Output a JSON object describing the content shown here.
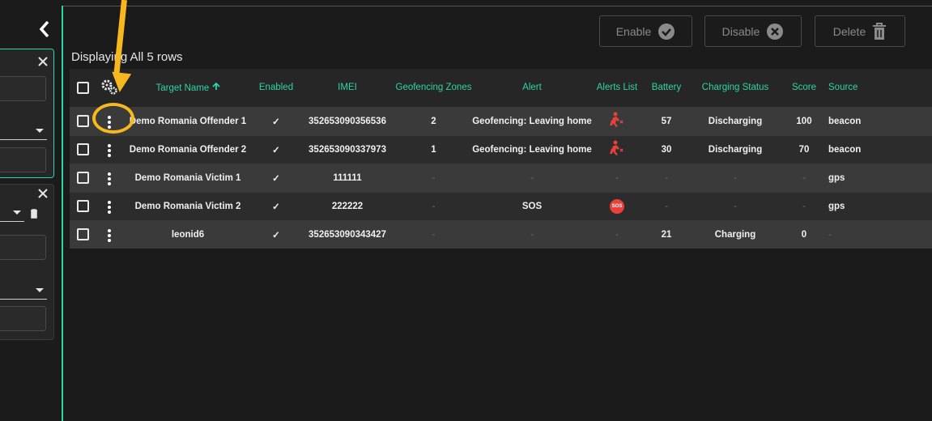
{
  "toolbar": {
    "enable_label": "Enable",
    "disable_label": "Disable",
    "delete_label": "Delete"
  },
  "caption": "Displaying All 5 rows",
  "table": {
    "headers": {
      "target_name": "Target Name",
      "enabled": "Enabled",
      "imei": "IMEI",
      "geofencing_zones": "Geofencing Zones",
      "alert": "Alert",
      "alerts_list": "Alerts List",
      "battery": "Battery",
      "charging_status": "Charging Status",
      "score": "Score",
      "source": "Source"
    },
    "rows": [
      {
        "target_name": "Demo Romania Offender 1",
        "enabled": "✓",
        "imei": "352653090356536",
        "geofencing_zones": "2",
        "alert": "Geofencing: Leaving home",
        "alerts_list_icon": "running-person-alert-icon",
        "battery": "57",
        "charging_status": "Discharging",
        "score": "100",
        "source": "beacon"
      },
      {
        "target_name": "Demo Romania Offender 2",
        "enabled": "✓",
        "imei": "352653090337973",
        "geofencing_zones": "1",
        "alert": "Geofencing: Leaving home",
        "alerts_list_icon": "running-person-alert-icon",
        "battery": "30",
        "charging_status": "Discharging",
        "score": "70",
        "source": "beacon"
      },
      {
        "target_name": "Demo Romania Victim 1",
        "enabled": "✓",
        "imei": "111111",
        "geofencing_zones": "-",
        "alert": "-",
        "alerts_list": "-",
        "battery": "-",
        "charging_status": "-",
        "score": "-",
        "source": "gps"
      },
      {
        "target_name": "Demo Romania Victim 2",
        "enabled": "✓",
        "imei": "222222",
        "geofencing_zones": "-",
        "alert": "SOS",
        "alerts_list_badge": "SOS",
        "battery": "-",
        "charging_status": "-",
        "score": "-",
        "source": "gps"
      },
      {
        "target_name": "leonid6",
        "enabled": "✓",
        "imei": "352653090343427",
        "geofencing_zones": "-",
        "alert": "-",
        "alerts_list": "-",
        "battery": "21",
        "charging_status": "Charging",
        "score": "0",
        "source": "-"
      }
    ]
  },
  "colors": {
    "accent": "#2dd4a8",
    "annotation": "#f7b81e",
    "alert_red": "#e8413a",
    "background": "#1b1b1b"
  }
}
